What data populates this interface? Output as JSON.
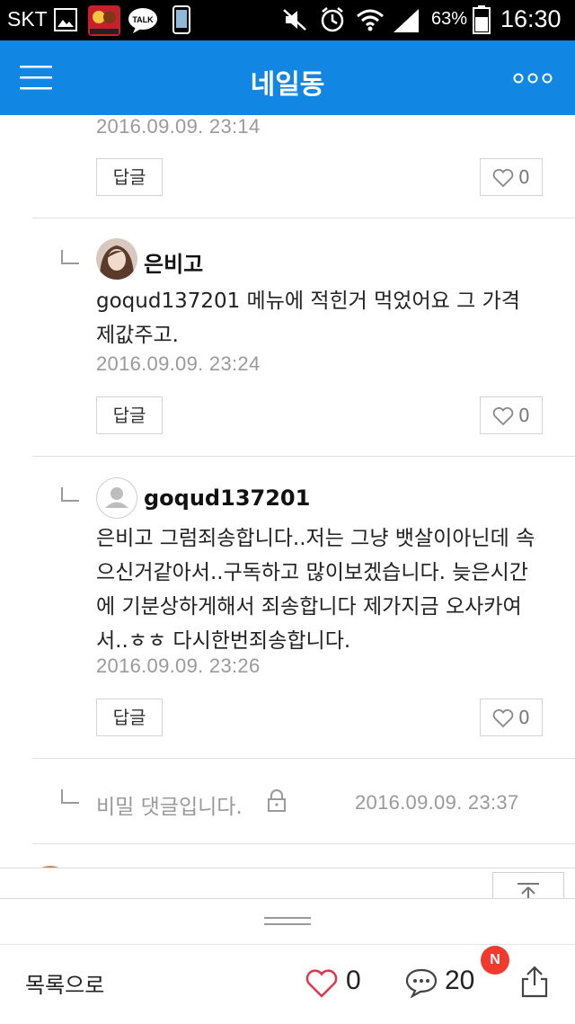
{
  "status_bar": {
    "carrier": "SKT",
    "battery_percent": "63%",
    "time": "16:30",
    "icons": [
      "image-icon",
      "netmarble-app-icon",
      "kakaotalk-icon",
      "phone-icon",
      "mute-icon",
      "alarm-icon",
      "wifi-icon",
      "signal-icon",
      "battery-icon"
    ]
  },
  "header": {
    "title": "네일동",
    "menu_icon": "hamburger-menu-icon",
    "more_icon": "more-dots-icon",
    "background": "#1186e2"
  },
  "comments": [
    {
      "timestamp": "2016.09.09. 23:14",
      "reply_label": "답글",
      "likes": "0"
    },
    {
      "author": "은비고",
      "text": "goqud137201 메뉴에 적힌거 먹었어요 그 가격 제값주고.",
      "timestamp": "2016.09.09. 23:24",
      "reply_label": "답글",
      "likes": "0"
    },
    {
      "author": "goqud137201",
      "text": "은비고 그럼죄송합니다..저는 그냥 뱃살이아닌데 속으신거같아서..구독하고 많이보겠습니다. 늦은시간에 기분상하게해서 죄송합니다 제가지금 오사카여서..ㅎㅎ 다시한번죄송합니다.",
      "timestamp": "2016.09.09. 23:26",
      "reply_label": "답글",
      "likes": "0"
    },
    {
      "secret_text": "비밀 댓글입니다.",
      "timestamp": "2016.09.09. 23:37"
    }
  ],
  "bottom_bar": {
    "list_label": "목록으로",
    "like_count": "0",
    "comment_count": "20",
    "new_badge": "N",
    "accent_like": "#e0364a",
    "badge_color": "#f03a2e"
  }
}
